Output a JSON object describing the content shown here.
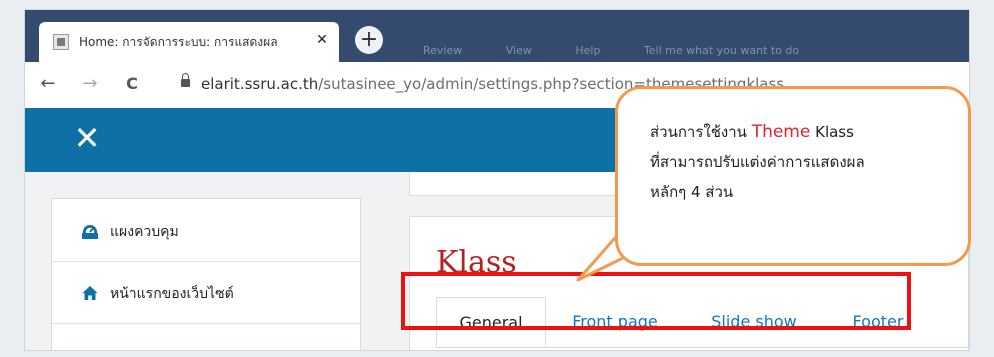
{
  "browser": {
    "tab_title": "Home: การจัดการระบบ: การแสดงผล",
    "tab_close": "✕",
    "new_tab": "+",
    "bg_menu": [
      "Review",
      "View",
      "Help",
      "Tell me what you want to do"
    ],
    "url_host": "elarit.ssru.ac.th",
    "url_path": "/sutasinee_yo/admin/settings.php?section=themesettingklass",
    "back": "←",
    "forward": "→",
    "reload": "C"
  },
  "header": {
    "close": "✕"
  },
  "sidebar": {
    "items": [
      {
        "label": "แผงควบคุม",
        "icon": "dashboard-icon"
      },
      {
        "label": "หน้าแรกของเว็บไซต์",
        "icon": "home-icon"
      }
    ]
  },
  "card": {
    "title": "Klass",
    "tabs": [
      "General",
      "Front page",
      "Slide show",
      "Footer"
    ],
    "active_tab": "General"
  },
  "callout": {
    "line1_a": "ส่วนการใช้งาน",
    "line1_theme": "Theme",
    "line1_b": "Klass",
    "line2": "ที่สามารถปรับแต่งค่าการแสดงผล",
    "line3": "หลักๆ 4 ส่วน"
  },
  "colors": {
    "tabstrip": "#344b6d",
    "header": "#0f70a6",
    "title": "#b22222",
    "link": "#1177c4",
    "highlight_box": "#ee1111",
    "callout_border": "#f29a4e"
  }
}
